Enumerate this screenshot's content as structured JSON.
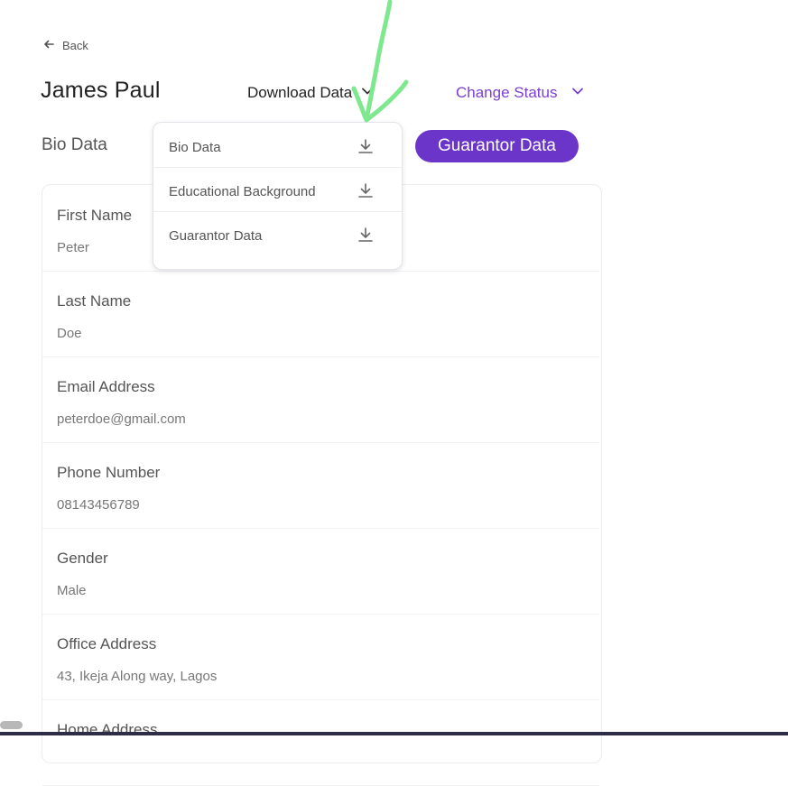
{
  "back": {
    "label": "Back",
    "icon": "arrow-left-icon"
  },
  "header": {
    "name": "James Paul",
    "download_label": "Download Data",
    "change_status_label": "Change Status"
  },
  "tabs": {
    "bio_data": "Bio Data",
    "guarantor_data": "Guarantor Data"
  },
  "colors": {
    "accent": "#6c35c9",
    "accent_text": "#7b3fd4",
    "annotation": "#7ee88e"
  },
  "download_menu": {
    "items": [
      {
        "label": "Bio Data",
        "icon": "download-icon"
      },
      {
        "label": "Educational Background",
        "icon": "download-icon"
      },
      {
        "label": "Guarantor Data",
        "icon": "download-icon"
      }
    ]
  },
  "fields": [
    {
      "label": "First Name",
      "value": "Peter"
    },
    {
      "label": "Last Name",
      "value": "Doe"
    },
    {
      "label": "Email Address",
      "value": "peterdoe@gmail.com"
    },
    {
      "label": "Phone Number",
      "value": "08143456789"
    },
    {
      "label": "Gender",
      "value": "Male"
    },
    {
      "label": "Office Address",
      "value": "43, Ikeja Along way, Lagos"
    },
    {
      "label": "Home Address",
      "value": ""
    }
  ]
}
